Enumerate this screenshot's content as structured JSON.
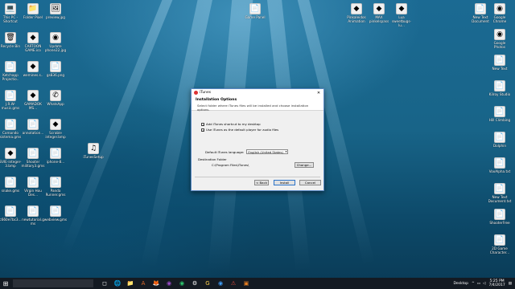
{
  "desktop": {
    "icons_left": [
      {
        "label": "This PC - Shortcut",
        "glyph": "💻"
      },
      {
        "label": "Folder Pixel",
        "glyph": "📁"
      },
      {
        "label": "preview.jpg",
        "glyph": "🖼"
      },
      {
        "label": "Recycle Bin",
        "glyph": "🗑"
      },
      {
        "label": "CARTOON GAME.ico",
        "glyph": "◆"
      },
      {
        "label": "Update phone22.jpg",
        "glyph": "◉"
      },
      {
        "label": "Ketchapp Projectio..",
        "glyph": "📄"
      },
      {
        "label": "wemines.s..",
        "glyph": "◆"
      },
      {
        "label": "gs836.png",
        "glyph": "📄"
      },
      {
        "label": "J.R.W-music.gms",
        "glyph": "📄"
      },
      {
        "label": "GAMADOK MS...",
        "glyph": "◆"
      },
      {
        "label": "WhatsApp",
        "glyph": "✆"
      },
      {
        "label": "Comando sistema.gms",
        "glyph": "📄"
      },
      {
        "label": "annotation...",
        "glyph": "📄"
      },
      {
        "label": "Scrable integer.bmp",
        "glyph": "◆"
      },
      {
        "label": "SVIE-integer-3.bmp",
        "glyph": "◆"
      },
      {
        "label": "Shooter military3.gms",
        "glyph": "📄"
      },
      {
        "label": "iphone-8...",
        "glyph": "📄"
      },
      {
        "label": "snake.gms",
        "glyph": "📄"
      },
      {
        "label": "Virgin Hou Des...",
        "glyph": "📄"
      },
      {
        "label": "Panda Runner.gms",
        "glyph": "📄"
      },
      {
        "label": "c660e7bc3...",
        "glyph": "📄"
      },
      {
        "label": "newtutorial.gms",
        "glyph": "📄"
      },
      {
        "label": "webview.gms",
        "glyph": "📄"
      }
    ],
    "icon_mid": {
      "label": "iTunesSetup",
      "glyph": "♫"
    },
    "icon_top_mid": {
      "label": "Game Panel",
      "glyph": "📄"
    },
    "icons_top_right": [
      {
        "label": "Pinkaleidos Animation",
        "glyph": "◆"
      },
      {
        "label": "MAX pinkelspass",
        "glyph": "◆"
      },
      {
        "label": "Lua sweetbugs-lu...",
        "glyph": "◆"
      }
    ],
    "icons_right": [
      {
        "label": "New Text Document",
        "glyph": "📄"
      },
      {
        "label": "Google Chrome",
        "glyph": "◉"
      },
      {
        "label": "Google Photos",
        "glyph": "◉"
      },
      {
        "label": "New Text",
        "glyph": "📄"
      },
      {
        "label": "Kilroy Studio",
        "glyph": "📄"
      },
      {
        "label": "Hill Climbing",
        "glyph": "📄"
      },
      {
        "label": "Dolphin",
        "glyph": "📄"
      },
      {
        "label": "VoxAlpha.txt",
        "glyph": "📄"
      },
      {
        "label": "New Text Document.txt",
        "glyph": "📄"
      },
      {
        "label": "ShooterFree",
        "glyph": "📄"
      },
      {
        "label": "2D Game Character...",
        "glyph": "📄"
      }
    ]
  },
  "dialog": {
    "title": "iTunes",
    "close_glyph": "✕",
    "heading": "Installation Options",
    "subheading": "Select folder where iTunes files will be installed and choose installation options.",
    "options": [
      {
        "label": "Add iTunes shortcut to my desktop",
        "checked": true
      },
      {
        "label": "Use iTunes as the default player for audio files",
        "checked": true
      }
    ],
    "language_label": "Default iTunes language:",
    "language_value": "English (United States)",
    "destination_label": "Destination Folder",
    "destination_path": "C:\\Program Files\\iTunes\\",
    "change_button": "Change...",
    "back_button": "< Back",
    "install_button": "Install",
    "cancel_button": "Cancel"
  },
  "taskbar": {
    "search_placeholder": "",
    "apps": [
      "◻",
      "🌐",
      "📁",
      "A",
      "🦊",
      "◉",
      "◉",
      "⚙",
      "G",
      "◉",
      "⚠",
      "▣"
    ],
    "desktop_label": "Desktop",
    "time": "5:25 PM",
    "date": "7/4/2017"
  }
}
